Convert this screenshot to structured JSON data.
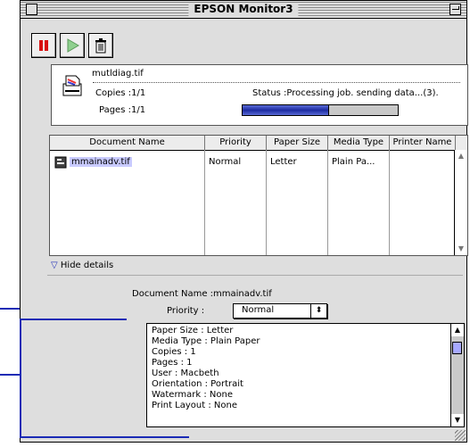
{
  "window": {
    "title": "EPSON Monitor3"
  },
  "toolbar": {
    "pause_label": "Pause",
    "resume_label": "Resume",
    "delete_label": "Delete"
  },
  "job": {
    "file": "mutldiag.tif",
    "copies": "Copies :1/1",
    "pages": "Pages :1/1",
    "status": "Status :Processing job. sending data...(3).",
    "progress_percent": 55
  },
  "queue": {
    "headers": [
      "Document Name",
      "Priority",
      "Paper Size",
      "Media Type",
      "Printer Name"
    ],
    "rows": [
      {
        "name": "mmainadv.tif",
        "priority": "Normal",
        "paper": "Letter",
        "media": "Plain Pa...",
        "printer": ""
      }
    ]
  },
  "details": {
    "toggle_label": "Hide details",
    "doc_name": "Document Name :mmainadv.tif",
    "priority_label": "Priority :",
    "priority_value": "Normal",
    "lines": [
      "Paper Size : Letter",
      "Media Type : Plain Paper",
      "Copies : 1",
      "Pages : 1",
      "User : Macbeth",
      "Orientation : Portrait",
      "Watermark : None",
      "Print Layout : None"
    ]
  },
  "colors": {
    "accent": "#1a2bb5",
    "window_bg": "#dedede",
    "selection": "#c9cbff"
  }
}
